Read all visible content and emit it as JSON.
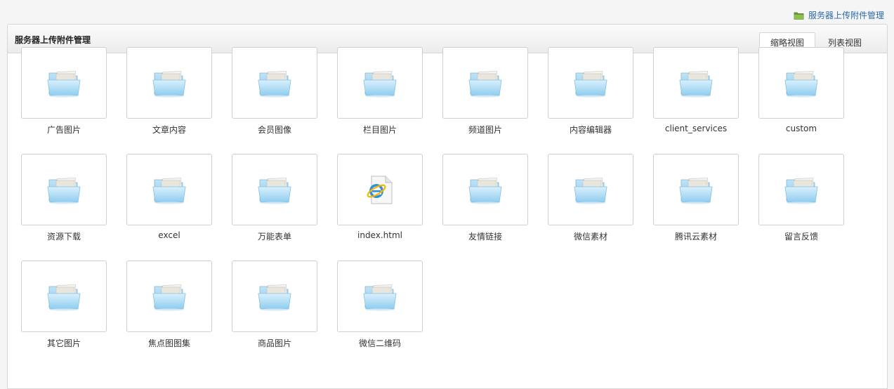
{
  "header": {
    "link_label": "服务器上传附件管理",
    "link_icon": "folder-icon"
  },
  "panel": {
    "title": "服务器上传附件管理",
    "tabs": [
      {
        "label": "缩略视图",
        "active": true
      },
      {
        "label": "列表视图",
        "active": false
      }
    ]
  },
  "items": [
    {
      "label": "广告图片",
      "icon": "folder-icon"
    },
    {
      "label": "文章内容",
      "icon": "folder-icon"
    },
    {
      "label": "会员图像",
      "icon": "folder-icon"
    },
    {
      "label": "栏目图片",
      "icon": "folder-icon"
    },
    {
      "label": "频道图片",
      "icon": "folder-icon"
    },
    {
      "label": "内容编辑器",
      "icon": "folder-icon"
    },
    {
      "label": "client_services",
      "icon": "folder-icon"
    },
    {
      "label": "custom",
      "icon": "folder-icon"
    },
    {
      "label": "资源下载",
      "icon": "folder-icon"
    },
    {
      "label": "excel",
      "icon": "folder-icon"
    },
    {
      "label": "万能表单",
      "icon": "folder-icon"
    },
    {
      "label": "index.html",
      "icon": "ie-html-file-icon"
    },
    {
      "label": "友情链接",
      "icon": "folder-icon"
    },
    {
      "label": "微信素材",
      "icon": "folder-icon"
    },
    {
      "label": "腾讯云素材",
      "icon": "folder-icon"
    },
    {
      "label": "留言反馈",
      "icon": "folder-icon"
    },
    {
      "label": "其它图片",
      "icon": "folder-icon"
    },
    {
      "label": "焦点图图集",
      "icon": "folder-icon"
    },
    {
      "label": "商品图片",
      "icon": "folder-icon"
    },
    {
      "label": "微信二维码",
      "icon": "folder-icon"
    }
  ]
}
